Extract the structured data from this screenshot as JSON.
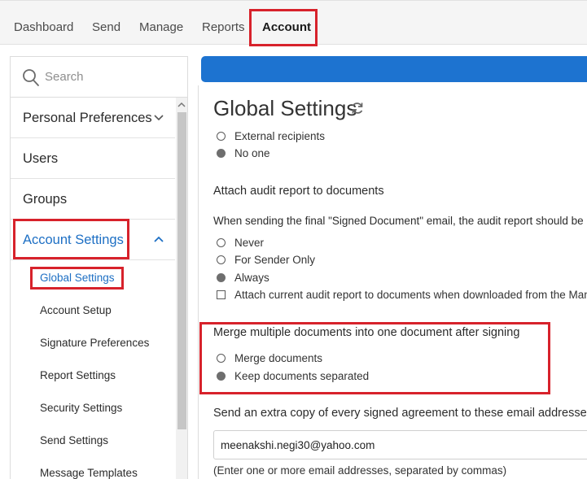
{
  "nav": {
    "items": [
      "Dashboard",
      "Send",
      "Manage",
      "Reports",
      "Account"
    ],
    "active": "Account"
  },
  "sidebar": {
    "search_placeholder": "Search",
    "items": [
      {
        "label": "Personal Preferences",
        "expandable": true,
        "expanded": false
      },
      {
        "label": "Users"
      },
      {
        "label": "Groups"
      },
      {
        "label": "Account Settings",
        "expandable": true,
        "expanded": true
      }
    ],
    "sub_items": [
      "Global Settings",
      "Account Setup",
      "Signature Preferences",
      "Report Settings",
      "Security Settings",
      "Send Settings",
      "Message Templates"
    ],
    "active_sub_item": "Global Settings"
  },
  "main": {
    "title": "Global Settings",
    "top_options": [
      {
        "label": "External recipients",
        "selected": false
      },
      {
        "label": "No one",
        "selected": true
      }
    ],
    "audit": {
      "title": "Attach audit report to documents",
      "description": "When sending the final \"Signed Document\" email, the audit report should be",
      "options": [
        {
          "label": "Never",
          "selected": false
        },
        {
          "label": "For Sender Only",
          "selected": false
        },
        {
          "label": "Always",
          "selected": true
        }
      ],
      "checkbox_label": "Attach current audit report to documents when downloaded from the Man",
      "checkbox_checked": false
    },
    "merge": {
      "title": "Merge multiple documents into one document after signing",
      "options": [
        {
          "label": "Merge documents",
          "selected": false
        },
        {
          "label": "Keep documents separated",
          "selected": true
        }
      ]
    },
    "extra_copy": {
      "title": "Send an extra copy of every signed agreement to these email addresses",
      "value": "meenakshi.negi30@yahoo.com",
      "hint": "(Enter one or more email addresses, separated by commas)"
    }
  },
  "colors": {
    "highlight": "#d7222b",
    "accent_blue": "#1d73d0",
    "link_blue": "#1d6fc4"
  }
}
